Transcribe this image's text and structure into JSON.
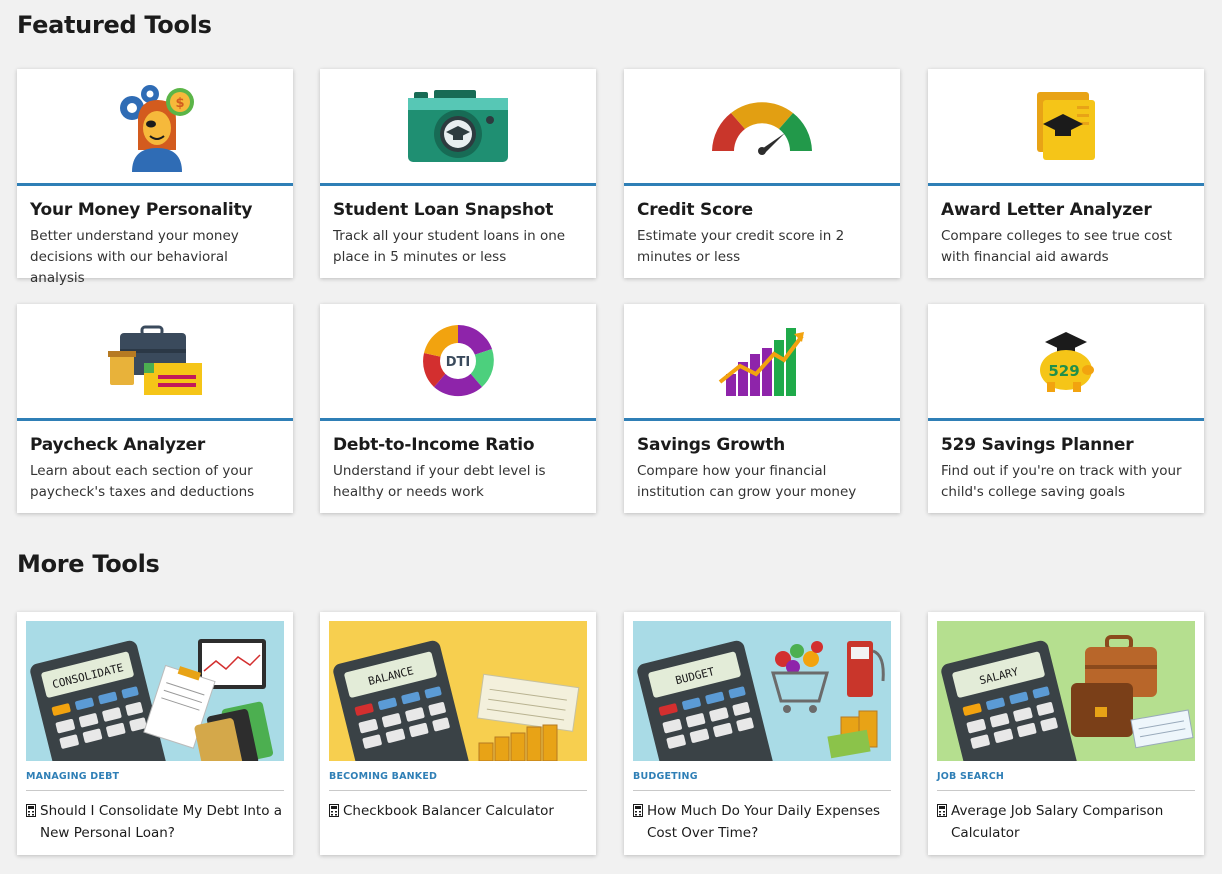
{
  "featured": {
    "title": "Featured Tools",
    "tools": [
      {
        "name": "Your Money Personality",
        "desc": "Better understand your money decisions with our behavioral analysis",
        "icon": "money-personality-icon"
      },
      {
        "name": "Student Loan Snapshot",
        "desc": "Track all your student loans in one place in 5 minutes or less",
        "icon": "camera-graduation-icon"
      },
      {
        "name": "Credit Score",
        "desc": "Estimate your credit score in 2 minutes or less",
        "icon": "gauge-icon"
      },
      {
        "name": "Award Letter Analyzer",
        "desc": "Compare colleges to see true cost with financial aid awards",
        "icon": "award-letter-icon"
      },
      {
        "name": "Paycheck Analyzer",
        "desc": "Learn about each section of your paycheck's taxes and deductions",
        "icon": "briefcase-paycheck-icon"
      },
      {
        "name": "Debt-to-Income Ratio",
        "desc": "Understand if your debt level is healthy or needs work",
        "icon": "dti-donut-icon",
        "icon_text": "DTI"
      },
      {
        "name": "Savings Growth",
        "desc": "Compare how your financial institution can grow your money",
        "icon": "bar-growth-icon"
      },
      {
        "name": "529 Savings Planner",
        "desc": "Find out if you're on track with your child's college saving goals",
        "icon": "piggy-bank-icon",
        "icon_text": "529"
      }
    ]
  },
  "more": {
    "title": "More Tools",
    "tools": [
      {
        "category": "Managing Debt",
        "label": "Should I Consolidate My Debt Into a New Personal Loan?",
        "screen": "CONSOLIDATE",
        "bg": "#a9dbe6"
      },
      {
        "category": "Becoming Banked",
        "label": "Checkbook Balancer Calculator",
        "screen": "BALANCE",
        "bg": "#f7cf4f"
      },
      {
        "category": "Budgeting",
        "label": "How Much Do Your Daily Expenses Cost Over Time?",
        "screen": "BUDGET",
        "bg": "#a9dbe6"
      },
      {
        "category": "Job Search",
        "label": "Average Job Salary Comparison Calculator",
        "screen": "SALARY",
        "bg": "#b5df8f"
      }
    ]
  },
  "colors": {
    "accent": "#2f7fb6",
    "text": "#1b1b1b",
    "background": "#f1f1f1"
  }
}
